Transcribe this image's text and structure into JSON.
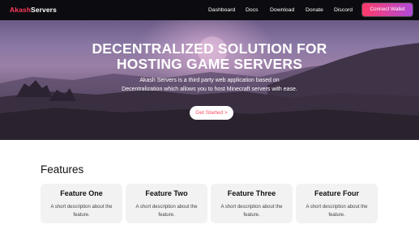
{
  "navbar": {
    "brand_part1": "Akash",
    "brand_part2": "Servers",
    "links": [
      "Dashboard",
      "Docs",
      "Download",
      "Donate",
      "Discord"
    ],
    "connect_label": "Connect Wallet"
  },
  "hero": {
    "title_line1": "DECENTRALIZED SOLUTION FOR",
    "title_line2": "HOSTING GAME SERVERS",
    "description": "Akash Servers is a third party web application based on Decentralization which allows you to host Minecraft servers with ease.",
    "cta_label": "Get Started >"
  },
  "features": {
    "heading": "Features",
    "cards": [
      {
        "title": "Feature One",
        "description": "A short description about the feature."
      },
      {
        "title": "Feature Two",
        "description": "A short description about the feature."
      },
      {
        "title": "Feature Three",
        "description": "A short description about the feature."
      },
      {
        "title": "Feature Four",
        "description": "A short description about the feature."
      }
    ]
  },
  "colors": {
    "navbar_bg": "#0c0c10",
    "brand_accent": "#ff3b5c",
    "button_gradient_start": "#ff3b6a",
    "button_gradient_end": "#b04bd9",
    "cta_text": "#ff4a5e",
    "card_bg": "#f2f2f2"
  }
}
